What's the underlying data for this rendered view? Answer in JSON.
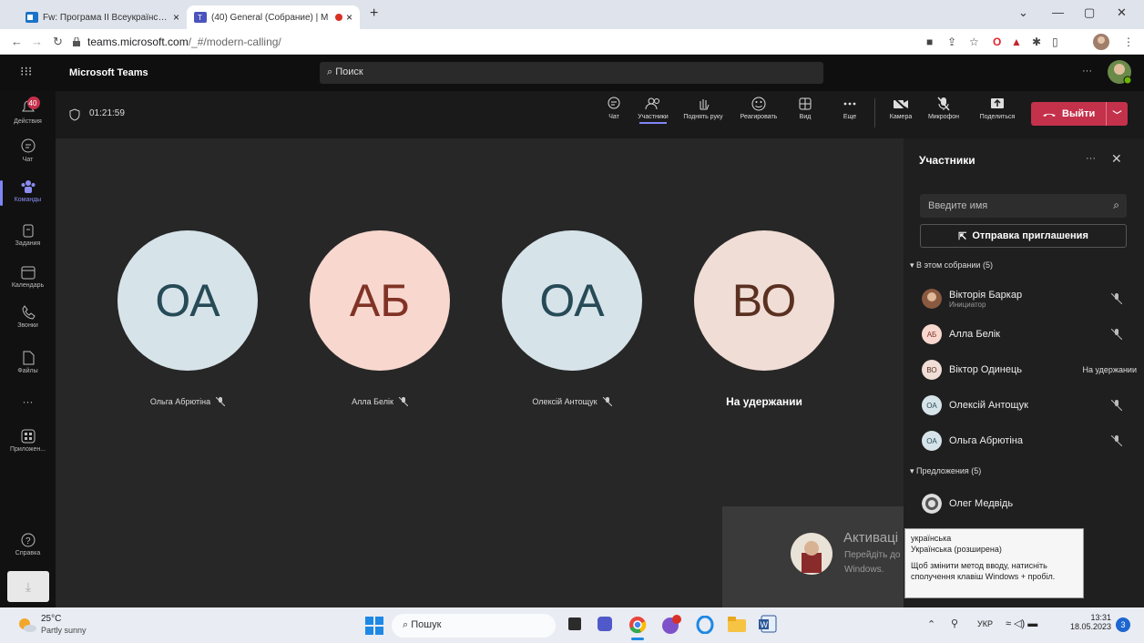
{
  "browser": {
    "tabs": [
      {
        "title": "Fw: Програма ІІ Всеукраїнської",
        "close": "×"
      },
      {
        "title": "(40) General (Собрание) | M",
        "close": "×"
      }
    ],
    "new_tab": "+",
    "url_host": "teams.microsoft.com",
    "url_path": "/_#/modern-calling/"
  },
  "teams": {
    "app_title": "Microsoft Teams",
    "search_placeholder": "Поиск",
    "more": "···"
  },
  "rail": [
    {
      "label": "Действия",
      "badge": "40",
      "icon": "bell-icon"
    },
    {
      "label": "Чат",
      "icon": "chat-icon"
    },
    {
      "label": "Команды",
      "icon": "teams-icon"
    },
    {
      "label": "Задания",
      "icon": "assignments-icon"
    },
    {
      "label": "Календарь",
      "icon": "calendar-icon"
    },
    {
      "label": "Звонки",
      "icon": "phone-icon"
    },
    {
      "label": "Файлы",
      "icon": "files-icon"
    },
    {
      "label": "···",
      "icon": "more-icon"
    },
    {
      "label": "Приложен...",
      "icon": "apps-icon"
    },
    {
      "label": "Справка",
      "icon": "help-icon"
    }
  ],
  "call": {
    "timer": "01:21:59",
    "controls": [
      {
        "label": "Чат",
        "icon": "chat-icon"
      },
      {
        "label": "Участники",
        "icon": "people-icon"
      },
      {
        "label": "Поднять руку",
        "icon": "hand-icon"
      },
      {
        "label": "Реагировать",
        "icon": "smile-icon"
      },
      {
        "label": "Вид",
        "icon": "grid-icon"
      },
      {
        "label": "Еще",
        "icon": "more-icon"
      },
      {
        "label": "Камера",
        "icon": "camera-off-icon"
      },
      {
        "label": "Микрофон",
        "icon": "mic-off-icon"
      },
      {
        "label": "Поделиться",
        "icon": "share-icon"
      }
    ],
    "leave": "Выйти"
  },
  "tiles": [
    {
      "initials": "ОА",
      "name": "Ольга Абрютіна",
      "bg": "#d6e4ea",
      "fg": "#274a57",
      "muted": true
    },
    {
      "initials": "АБ",
      "name": "Алла Белік",
      "bg": "#f8d7cf",
      "fg": "#803325",
      "muted": true
    },
    {
      "initials": "ОА",
      "name": "Олексій Антощук",
      "bg": "#d6e4ea",
      "fg": "#274a57",
      "muted": true
    },
    {
      "initials": "ВО",
      "name": "На удержании",
      "bg": "#f0ddd6",
      "fg": "#5a3020",
      "muted": false
    }
  ],
  "panel": {
    "title": "Участники",
    "search_placeholder": "Введите имя",
    "invite": "Отправка приглашения",
    "section_in": "В этом собрании (5)",
    "section_sug": "Предложения (5)",
    "participants": [
      {
        "name": "Вікторія Баркар",
        "sub": "Инициатор",
        "initials": "",
        "bg": "#8a5a40",
        "status": "mic-off"
      },
      {
        "name": "Алла Белік",
        "initials": "АБ",
        "bg": "#f8d7cf",
        "fg": "#803325",
        "status": "mic-off"
      },
      {
        "name": "Віктор Одинець",
        "initials": "ВО",
        "bg": "#f0ddd6",
        "fg": "#5a3020",
        "status": "На удержании"
      },
      {
        "name": "Олексій Антощук",
        "initials": "ОА",
        "bg": "#d6e4ea",
        "fg": "#274a57",
        "status": "mic-off"
      },
      {
        "name": "Ольга Абрютіна",
        "initials": "ОА",
        "bg": "#d6e4ea",
        "fg": "#274a57",
        "status": "mic-off"
      }
    ],
    "suggestions": [
      {
        "name": "Олег Медвідь"
      }
    ]
  },
  "windows_activation": {
    "title": "Активаці",
    "line1": "Перейдіть до",
    "line2": "Windows."
  },
  "ime_tooltip": {
    "line1": "українська",
    "line2": "Українська (розширена)",
    "line3": "Щоб змінити метод вводу, натисніть",
    "line4": "сполучення клавіш Windows + пробіл."
  },
  "taskbar": {
    "temp": "25°C",
    "weather": "Partly sunny",
    "search": "Пошук",
    "lang": "УКР",
    "time": "13:31",
    "date": "18.05.2023",
    "notif": "3"
  },
  "colors": {
    "accent": "#7f85f5",
    "leave": "#c4314b"
  }
}
